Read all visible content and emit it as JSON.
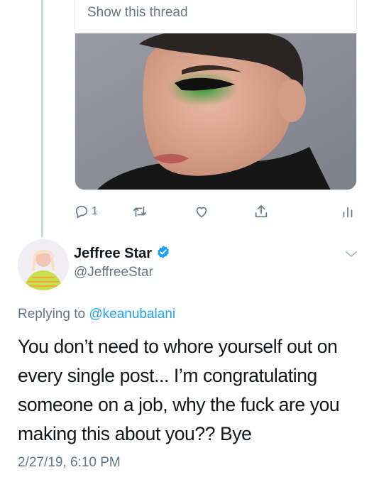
{
  "quoted_card": {
    "show_thread_label": "Show this thread"
  },
  "actions": {
    "reply_count": "1"
  },
  "author": {
    "display_name": "Jeffree Star",
    "handle": "@JeffreeStar",
    "verified": true
  },
  "reply_context": {
    "prefix": "Replying to",
    "mention": "@keanubalani"
  },
  "tweet": {
    "text": "You don’t need to whore yourself out on every single post... I’m congratulating someone on a job, why the fuck are you making this about you?? Bye",
    "timestamp": "2/27/19, 6:10 PM"
  },
  "colors": {
    "accent": "#1da1f2",
    "secondary_text": "#657786",
    "primary_text": "#14171a",
    "divider": "#e6ecf0"
  }
}
